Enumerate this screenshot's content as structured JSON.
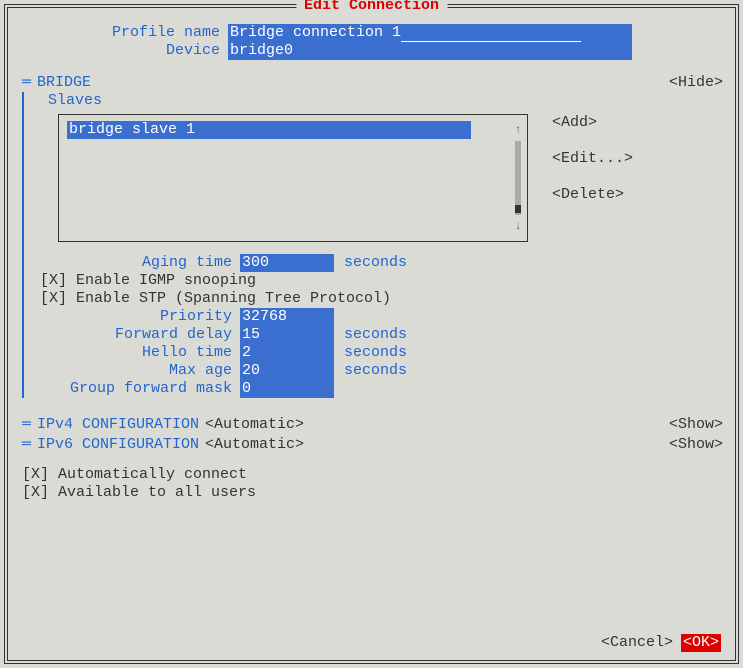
{
  "title": "Edit Connection",
  "profile": {
    "name_label": "Profile name",
    "name_value": "Bridge connection 1",
    "device_label": "Device",
    "device_value": "bridge0"
  },
  "bridge": {
    "heading": "BRIDGE",
    "hide": "<Hide>",
    "slaves_label": "Slaves",
    "slave0": "bridge slave 1",
    "add": "<Add>",
    "edit": "<Edit...>",
    "delete": "<Delete>",
    "aging_label": "Aging time",
    "aging_value": "300",
    "seconds": "seconds",
    "igmp": "[X] Enable IGMP snooping",
    "stp": "[X] Enable STP (Spanning Tree Protocol)",
    "priority_label": "Priority",
    "priority_value": "32768",
    "fwd_label": "Forward delay",
    "fwd_value": "15",
    "hello_label": "Hello time",
    "hello_value": "2",
    "maxage_label": "Max age",
    "maxage_value": "20",
    "gfm_label": "Group forward mask",
    "gfm_value": "0"
  },
  "ipv4": {
    "label": "IPv4 CONFIGURATION",
    "mode": "<Automatic>",
    "show": "<Show>"
  },
  "ipv6": {
    "label": "IPv6 CONFIGURATION",
    "mode": "<Automatic>",
    "show": "<Show>"
  },
  "autoconnect": "[X] Automatically connect",
  "allusers": "[X] Available to all users",
  "cancel": "<Cancel>",
  "ok": "<OK>"
}
